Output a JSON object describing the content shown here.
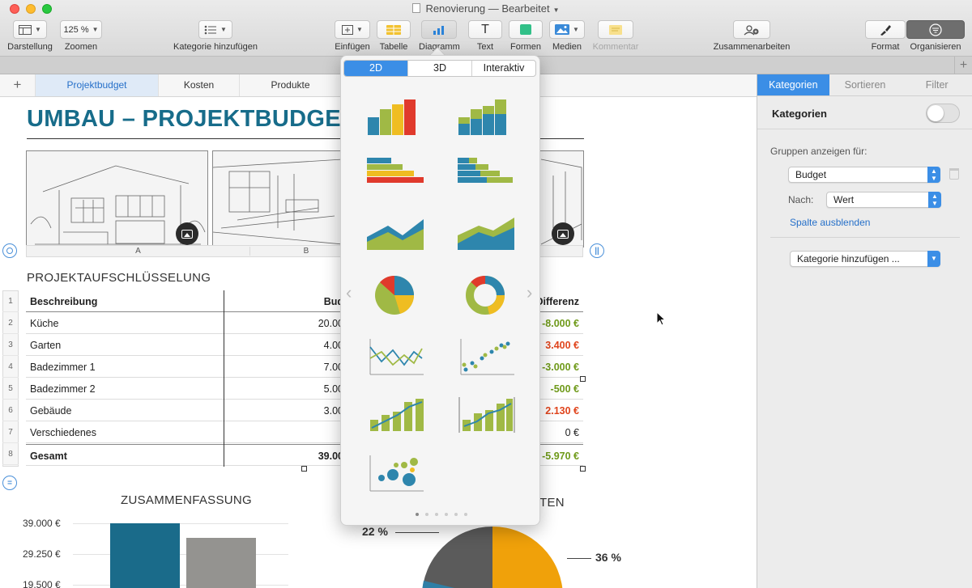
{
  "window": {
    "title": "Renovierung — Bearbeitet"
  },
  "toolbar": {
    "darstellung": "Darstellung",
    "zoom_value": "125 %",
    "zoom_label": "Zoomen",
    "kategorie": "Kategorie hinzufügen",
    "einfuegen": "Einfügen",
    "tabelle": "Tabelle",
    "diagramm": "Diagramm",
    "text": "Text",
    "formen": "Formen",
    "medien": "Medien",
    "kommentar": "Kommentar",
    "zusammenarbeiten": "Zusammenarbeiten",
    "format": "Format",
    "organisieren": "Organisieren",
    "text_icon_glyph": "T"
  },
  "tabs": [
    "Projektbudget",
    "Kosten",
    "Produkte"
  ],
  "document": {
    "title": "UMBAU – PROJEKTBUDGET",
    "columns": [
      "A",
      "B"
    ],
    "section_title": "PROJEKTAUFSCHLÜSSELUNG",
    "table": {
      "header": {
        "desc": "Beschreibung",
        "budget": "Bud",
        "diff": "Differenz"
      },
      "rows": [
        {
          "num": "2",
          "desc": "Küche",
          "budget": "20.00",
          "diff": "-8.000 €",
          "tone": "green"
        },
        {
          "num": "3",
          "desc": "Garten",
          "budget": "4.00",
          "diff": "3.400 €",
          "tone": "red"
        },
        {
          "num": "4",
          "desc": "Badezimmer 1",
          "budget": "7.00",
          "diff": "-3.000 €",
          "tone": "green"
        },
        {
          "num": "5",
          "desc": "Badezimmer 2",
          "budget": "5.00",
          "diff": "-500 €",
          "tone": "green"
        },
        {
          "num": "6",
          "desc": "Gebäude",
          "budget": "3.00",
          "diff": "2.130 €",
          "tone": "red"
        },
        {
          "num": "7",
          "desc": "Verschiedenes",
          "budget": "",
          "diff": "0 €",
          "tone": "plain"
        }
      ],
      "total": {
        "num": "8",
        "desc": "Gesamt",
        "budget": "39.00",
        "diff": "-5.970 €"
      },
      "header_num": "1"
    },
    "summary_title": "ZUSAMMENFASSUNG",
    "kosten_title": "TEN",
    "y_ticks": [
      "39.000 €",
      "29.250 €",
      "19.500 €"
    ],
    "pie_labels": {
      "left": "22 %",
      "right": "36 %"
    }
  },
  "chart_data": {
    "type": "bar",
    "title": "ZUSAMMENFASSUNG",
    "categories": [
      "",
      ""
    ],
    "values": [
      39000,
      34500
    ],
    "ylim": [
      19500,
      39000
    ],
    "y_ticks": [
      39000,
      29250,
      19500
    ],
    "colors": [
      "#1a6b8a",
      "#949390"
    ]
  },
  "popover": {
    "segments": [
      "2D",
      "3D",
      "Interaktiv"
    ],
    "active_segment": "2D",
    "chart_types": [
      "column",
      "stacked-column",
      "bar",
      "stacked-bar",
      "area",
      "stacked-area",
      "pie",
      "donut",
      "line",
      "scatter",
      "mixed",
      "two-axis",
      "bubble"
    ],
    "page_count": 6,
    "active_page": 0
  },
  "inspector": {
    "tabs": [
      "Kategorien",
      "Sortieren",
      "Filter"
    ],
    "active_tab": "Kategorien",
    "heading": "Kategorien",
    "group_label": "Gruppen anzeigen für:",
    "group_value": "Budget",
    "nach_label": "Nach:",
    "nach_value": "Wert",
    "hide_column": "Spalte ausblenden",
    "add_category": "Kategorie hinzufügen ..."
  },
  "colors": {
    "accent": "#3b8ee6",
    "title": "#176c8a",
    "green": "#6f9a1a",
    "red": "#e0441c"
  }
}
